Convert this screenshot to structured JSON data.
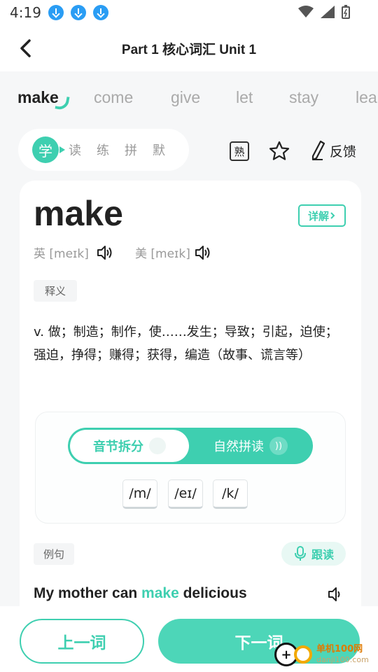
{
  "status_bar": {
    "time": "4:19",
    "download_icons": [
      "download-icon",
      "download-icon",
      "download-icon"
    ]
  },
  "header": {
    "title": "Part 1 核心词汇 Unit 1"
  },
  "word_tabs": [
    "make",
    "come",
    "give",
    "let",
    "stay",
    "lea"
  ],
  "mode_tabs": {
    "active": "学",
    "items": [
      "读",
      "练",
      "拼",
      "默"
    ]
  },
  "tools": {
    "familiar": "熟",
    "feedback": "反馈"
  },
  "word": {
    "headword": "make",
    "detail_label": "详解",
    "uk_phonetic": "英 [meɪk]",
    "us_phonetic": "美 [meɪk]",
    "definition_tag": "释义",
    "definition": "v. 做；制造；制作，使……发生；导致；引起，迫使；强迫，挣得；赚得；获得，编造（故事、谎言等）"
  },
  "phonics": {
    "mode_left": "音节拆分",
    "mode_right": "自然拼读",
    "syllables": [
      "/m/",
      "/eɪ/",
      "/k/"
    ]
  },
  "example": {
    "tag": "例句",
    "follow_label": "跟读",
    "before": "My mother can ",
    "highlight": "make",
    "after": " delicious"
  },
  "footer": {
    "prev_label": "上一词",
    "next_label": "下一词"
  },
  "watermark": {
    "name": "单机100网",
    "url": "danji100.com"
  },
  "colors": {
    "accent": "#3ecfb0",
    "background": "#f6f7f8"
  }
}
